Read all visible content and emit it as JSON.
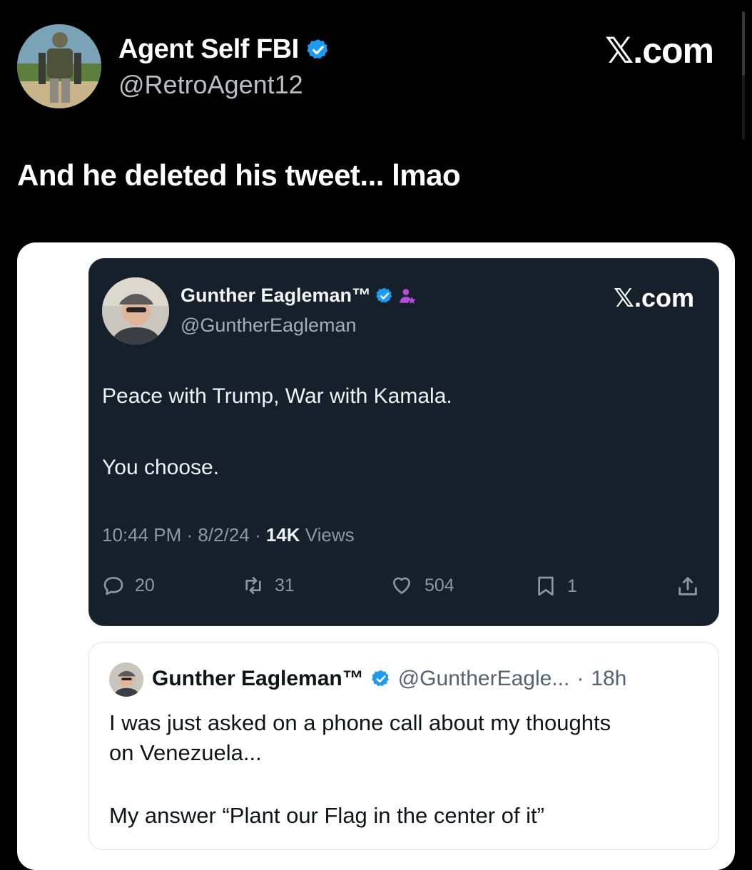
{
  "outer": {
    "name": "Agent Self FBI",
    "handle": "@RetroAgent12",
    "brand": "𝕏.com",
    "text": "And he deleted his tweet... lmao",
    "icons": {
      "verified": "verified-badge-icon"
    }
  },
  "inner": {
    "name": "Gunther Eagleman™",
    "handle": "@GuntherEagleman",
    "brand": "𝕏.com",
    "text_line1": "Peace with Trump, War with Kamala.",
    "text_line2": "You choose.",
    "time": "10:44 PM",
    "date": "8/2/24",
    "views_count": "14K",
    "views_label": "Views",
    "replies": "20",
    "reposts": "31",
    "likes": "504",
    "bookmarks": "1",
    "icons": {
      "verified": "verified-badge-icon",
      "affiliate": "affiliate-badge-icon",
      "reply": "reply-icon",
      "repost": "repost-icon",
      "like": "heart-icon",
      "bookmark": "bookmark-icon",
      "share": "share-icon"
    }
  },
  "quote": {
    "name": "Gunther Eagleman™",
    "handle": "@GuntherEagle...",
    "age": "18h",
    "line1": "I was just asked on a phone call about my thoughts",
    "line2": "on Venezuela...",
    "line3": "My answer “Plant our Flag in the center of it”"
  },
  "colors": {
    "background": "#000000",
    "verified_blue": "#1d9bf0",
    "dark_card": "#15202b",
    "affiliate_purple": "#b44fd6"
  }
}
